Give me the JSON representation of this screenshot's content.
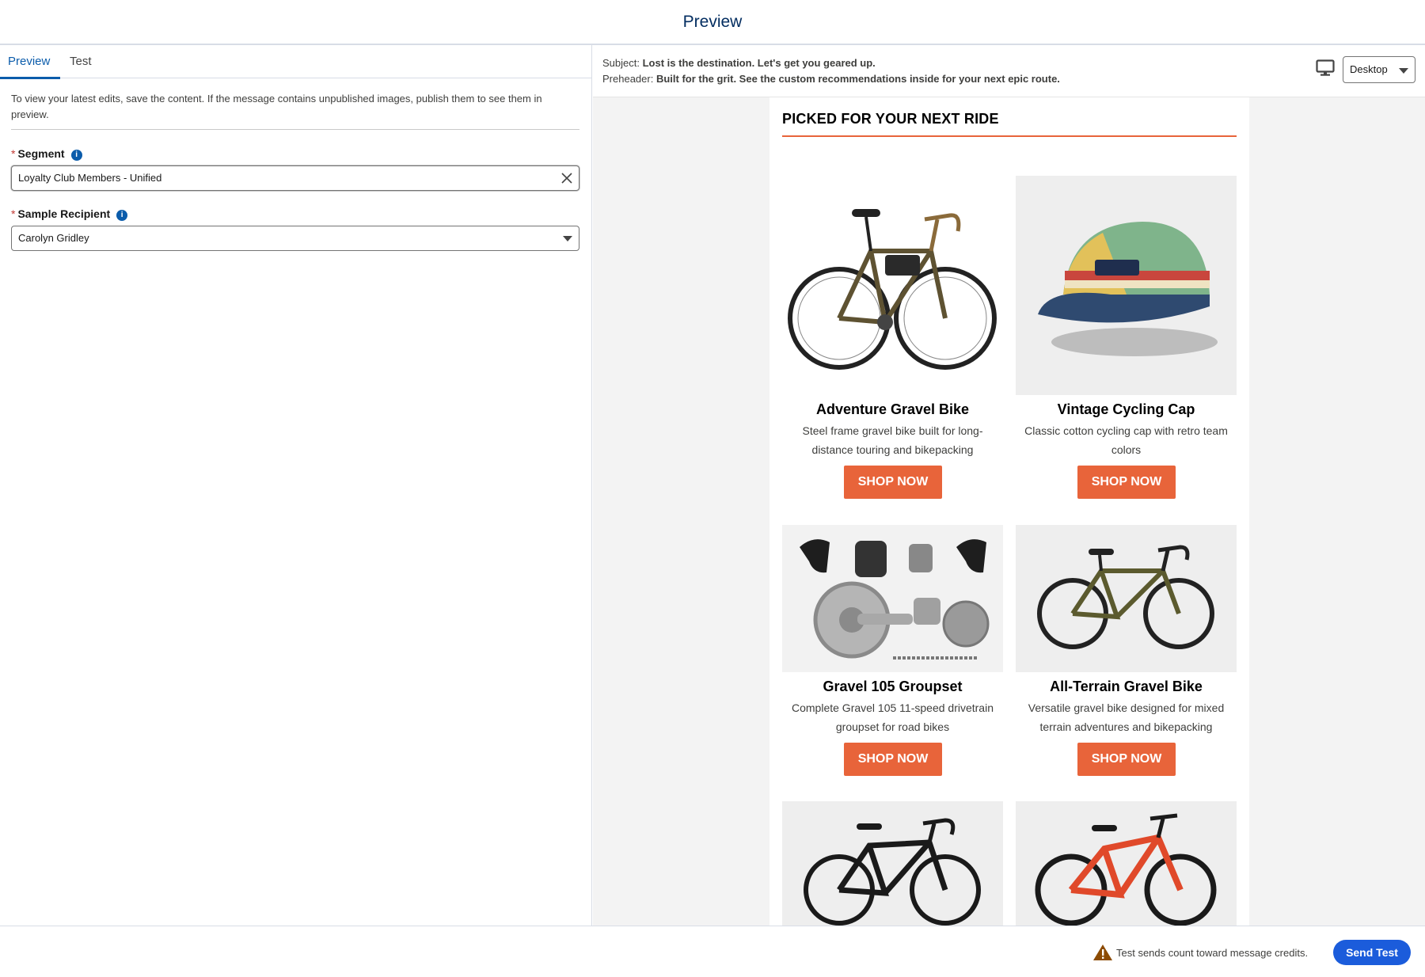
{
  "header": {
    "title": "Preview"
  },
  "tabs": [
    {
      "label": "Preview",
      "active": true
    },
    {
      "label": "Test",
      "active": false
    }
  ],
  "note": "To view your latest edits, save the content. If the message contains unpublished images, publish them to see them in preview.",
  "fields": {
    "segment": {
      "required_mark": "*",
      "label": "Segment",
      "info_icon": "i",
      "value": "Loyalty Club Members - Unified"
    },
    "recipient": {
      "required_mark": "*",
      "label": "Sample Recipient",
      "info_icon": "i",
      "value": "Carolyn Gridley"
    }
  },
  "preview": {
    "subject_label": "Subject:",
    "subject": "Lost is the destination. Let's get you geared up.",
    "preheader_label": "Preheader:",
    "preheader": "Built for the grit. See the custom recommendations inside for your next epic route.",
    "device": "Desktop"
  },
  "email": {
    "heading": "PICKED FOR YOUR NEXT RIDE",
    "accent_color": "#e8643a",
    "products": [
      {
        "name": "Adventure Gravel Bike",
        "desc": "Steel frame gravel bike built for long-distance touring and bikepacking",
        "cta": "SHOP NOW"
      },
      {
        "name": "Vintage Cycling Cap",
        "desc": "Classic cotton cycling cap with retro team colors",
        "cta": "SHOP NOW"
      },
      {
        "name": "Gravel 105 Groupset",
        "desc": "Complete Gravel 105 11-speed drivetrain groupset for road bikes",
        "cta": "SHOP NOW"
      },
      {
        "name": "All-Terrain Gravel Bike",
        "desc": "Versatile gravel bike designed for mixed terrain adventures and bikepacking",
        "cta": "SHOP NOW"
      }
    ]
  },
  "footer": {
    "warning": "Test sends count toward message credits.",
    "send_label": "Send Test"
  }
}
